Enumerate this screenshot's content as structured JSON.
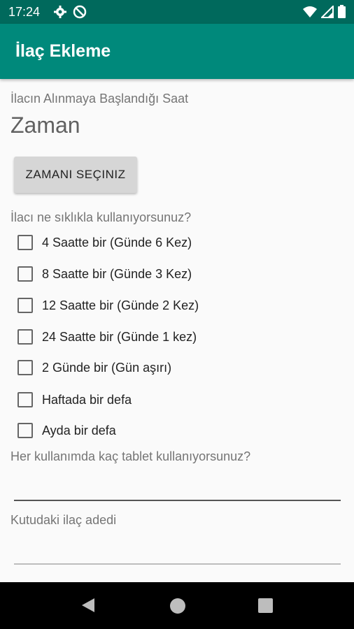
{
  "status_bar": {
    "time": "17:24",
    "left_icons": [
      "gear-icon",
      "no-disturb-icon"
    ],
    "right_icons": [
      "wifi-icon",
      "signal-icon",
      "battery-icon"
    ]
  },
  "app_bar": {
    "title": "İlaç Ekleme",
    "color": "#00897b"
  },
  "form": {
    "start_time_label": "İlacın Alınmaya Başlandığı Saat",
    "time_value": "Zaman",
    "select_time_button": "ZAMANI SEÇINIZ",
    "frequency_label": "İlacı ne sıklıkla kullanıyorsunuz?",
    "frequency_options": [
      {
        "label": "4 Saatte bir (Günde 6 Kez)",
        "checked": false
      },
      {
        "label": "8 Saatte bir (Günde 3 Kez)",
        "checked": false
      },
      {
        "label": "12 Saatte bir (Günde 2 Kez)",
        "checked": false
      },
      {
        "label": "24 Saatte bir (Günde 1 kez)",
        "checked": false
      },
      {
        "label": "2 Günde bir (Gün aşırı)",
        "checked": false
      },
      {
        "label": "Haftada bir defa",
        "checked": false
      },
      {
        "label": "Ayda bir defa",
        "checked": false
      }
    ],
    "tablet_count_label": "Her kullanımda kaç tablet kullanıyorsunuz?",
    "tablet_count_value": "",
    "box_count_label": "Kutudaki ilaç adedi",
    "box_count_value": ""
  },
  "nav_bar": {
    "icons": [
      "back-icon",
      "home-icon",
      "recents-icon"
    ]
  }
}
